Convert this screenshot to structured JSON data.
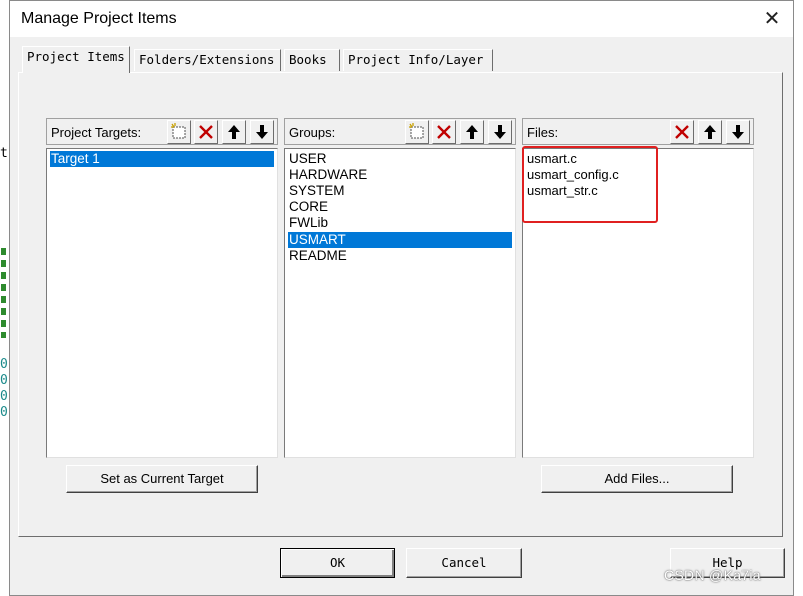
{
  "window": {
    "title": "Manage Project Items"
  },
  "tabs": [
    {
      "label": "Project Items"
    },
    {
      "label": "Folders/Extensions"
    },
    {
      "label": "Books"
    },
    {
      "label": "Project Info/Layer"
    }
  ],
  "targets": {
    "header": "Project Targets:",
    "items": [
      "Target 1"
    ],
    "selected": "Target 1"
  },
  "groups": {
    "header": "Groups:",
    "items": [
      "USER",
      "HARDWARE",
      "SYSTEM",
      "CORE",
      "FWLib",
      "USMART",
      "README"
    ],
    "selected": "USMART"
  },
  "files": {
    "header": "Files:",
    "items": [
      "usmart.c",
      "usmart_config.c",
      "usmart_str.c"
    ]
  },
  "buttons": {
    "set_current_target": "Set as Current Target",
    "add_files": "Add Files...",
    "ok": "OK",
    "cancel": "Cancel",
    "help": "Help"
  },
  "watermark": "CSDN @Ka7ia",
  "background_editor_chars": [
    "t",
    "0",
    "0",
    "0",
    "0"
  ],
  "colors": {
    "selection": "#0078d7",
    "delete_icon": "#c00000",
    "highlight_box": "#e02020",
    "dialog_bg": "#f0f0f0"
  },
  "icons": [
    "new-item-icon",
    "delete-icon",
    "move-up-icon",
    "move-down-icon",
    "close-icon"
  ]
}
